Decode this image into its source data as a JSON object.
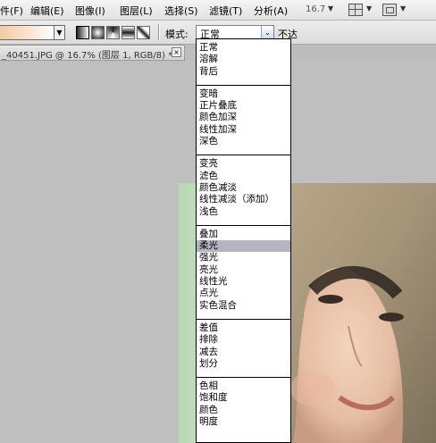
{
  "menubar": {
    "items": [
      "件(F)",
      "编辑(E)",
      "图像(I)",
      "图层(L)",
      "选择(S)",
      "滤镜(T)",
      "分析(A)"
    ],
    "zoom": "16.7"
  },
  "options": {
    "mode_label": "模式:",
    "mode_value": "正常",
    "opacity_label": "不达"
  },
  "document": {
    "tab_title": "_40451.JPG @ 16.7% (图层 1, RGB/8) *",
    "close_glyph": "×"
  },
  "blend_modes": {
    "groups": [
      [
        "正常",
        "溶解",
        "背后"
      ],
      [
        "变暗",
        "正片叠底",
        "颜色加深",
        "线性加深",
        "深色"
      ],
      [
        "变亮",
        "滤色",
        "颜色减淡",
        "线性减淡（添加）",
        "浅色"
      ],
      [
        "叠加",
        "柔光",
        "强光",
        "亮光",
        "线性光",
        "点光",
        "实色混合"
      ],
      [
        "差值",
        "排除",
        "减去",
        "划分"
      ],
      [
        "色相",
        "饱和度",
        "颜色",
        "明度"
      ]
    ],
    "highlighted": "柔光"
  },
  "icons": {
    "dropdown_arrow": "▼",
    "select_arrow": "⌄"
  }
}
